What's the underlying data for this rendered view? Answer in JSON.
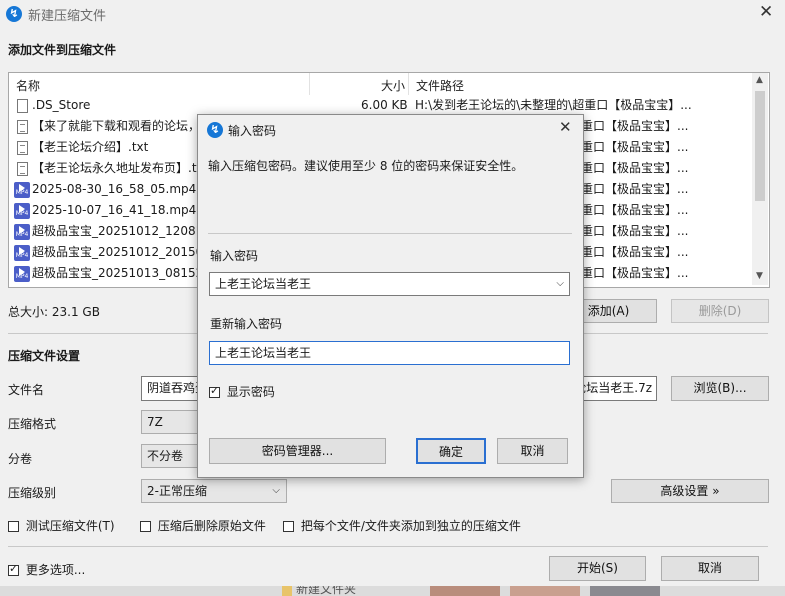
{
  "window": {
    "title": "新建压缩文件",
    "icon": "app-logo-icon"
  },
  "add_section": {
    "title": "添加文件到压缩文件"
  },
  "file_list": {
    "columns": [
      "名称",
      "大小",
      "文件路径"
    ],
    "rows": [
      {
        "name": ".DS_Store",
        "size": "6.00 KB",
        "path": "H:\\发到老王论坛的\\未整理的\\超重口【极品宝宝】...",
        "icon": "file"
      },
      {
        "name": "【来了就能下载和观看的论坛，",
        "size": "",
        "path": "超重口【极品宝宝】...",
        "icon": "txt"
      },
      {
        "name": "【老王论坛介绍】.txt",
        "size": "",
        "path": "超重口【极品宝宝】...",
        "icon": "txt"
      },
      {
        "name": "【老王论坛永久地址发布页】.tx",
        "size": "",
        "path": "超重口【极品宝宝】...",
        "icon": "txt"
      },
      {
        "name": "2025-08-30_16_58_05.mp4",
        "size": "",
        "path": "超重口【极品宝宝】...",
        "icon": "mp4"
      },
      {
        "name": "2025-10-07_16_41_18.mp4",
        "size": "",
        "path": "超重口【极品宝宝】...",
        "icon": "mp4"
      },
      {
        "name": "超极品宝宝_20251012_120812",
        "size": "",
        "path": "超重口【极品宝宝】...",
        "icon": "mp4"
      },
      {
        "name": "超极品宝宝_20251012_201508",
        "size": "",
        "path": "超重口【极品宝宝】...",
        "icon": "mp4"
      },
      {
        "name": "超极品宝宝_20251013_081525",
        "size": "",
        "path": "超重口【极品宝宝】...",
        "icon": "mp4"
      }
    ]
  },
  "total_size": "总大小: 23.1 GB",
  "list_buttons": {
    "add": "添加(A)",
    "delete": "删除(D)"
  },
  "settings": {
    "title": "压缩文件设置",
    "filename_label": "文件名",
    "filename_value": "阴道吞鸡蛋",
    "filename_tail": "论坛当老王.7z",
    "browse": "浏览(B)...",
    "format_label": "压缩格式",
    "format_value": "7Z",
    "split_label": "分卷",
    "split_value": "不分卷",
    "level_label": "压缩级别",
    "level_value": "2-正常压缩",
    "advanced": "高级设置 »",
    "opt_test": "测试压缩文件(T)",
    "opt_delete": "压缩后删除原始文件",
    "opt_each": "把每个文件/文件夹添加到独立的压缩文件"
  },
  "footer": {
    "more_options": "更多选项...",
    "start": "开始(S)",
    "cancel": "取消"
  },
  "password_dialog": {
    "title": "输入密码",
    "hint": "输入压缩包密码。建议使用至少 8 位的密码来保证安全性。",
    "pwd_label": "输入密码",
    "pwd_value": "上老王论坛当老王",
    "repeat_label": "重新输入密码",
    "repeat_value": "上老王论坛当老王",
    "show_password": "显示密码",
    "manager": "密码管理器...",
    "ok": "确定",
    "cancel": "取消"
  },
  "taskbar_peek": "新建文件夹"
}
